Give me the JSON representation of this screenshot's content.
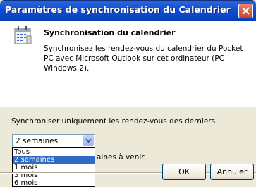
{
  "window": {
    "title": "Paramètres de synchronisation du Calendrier"
  },
  "header": {
    "title": "Synchronisation du calendrier",
    "description": "Synchronisez les rendez-vous du calendrier du Pocket PC avec Microsoft Outlook sur cet ordinateur (PC Windows 2).",
    "icon": "calendar-icon"
  },
  "sync": {
    "label": "Synchroniser uniquement les rendez-vous des derniers",
    "selected_value": "2 semaines",
    "options": [
      "Tous",
      "2 semaines",
      "1 mois",
      "3 mois",
      "6 mois"
    ],
    "partially_hidden_text": "aines à venir"
  },
  "buttons": {
    "ok": "OK",
    "cancel": "Annuler"
  },
  "colors": {
    "titlebar": "#0f4fd6",
    "selection": "#316ac5",
    "dialog_bg": "#ece9d8"
  }
}
